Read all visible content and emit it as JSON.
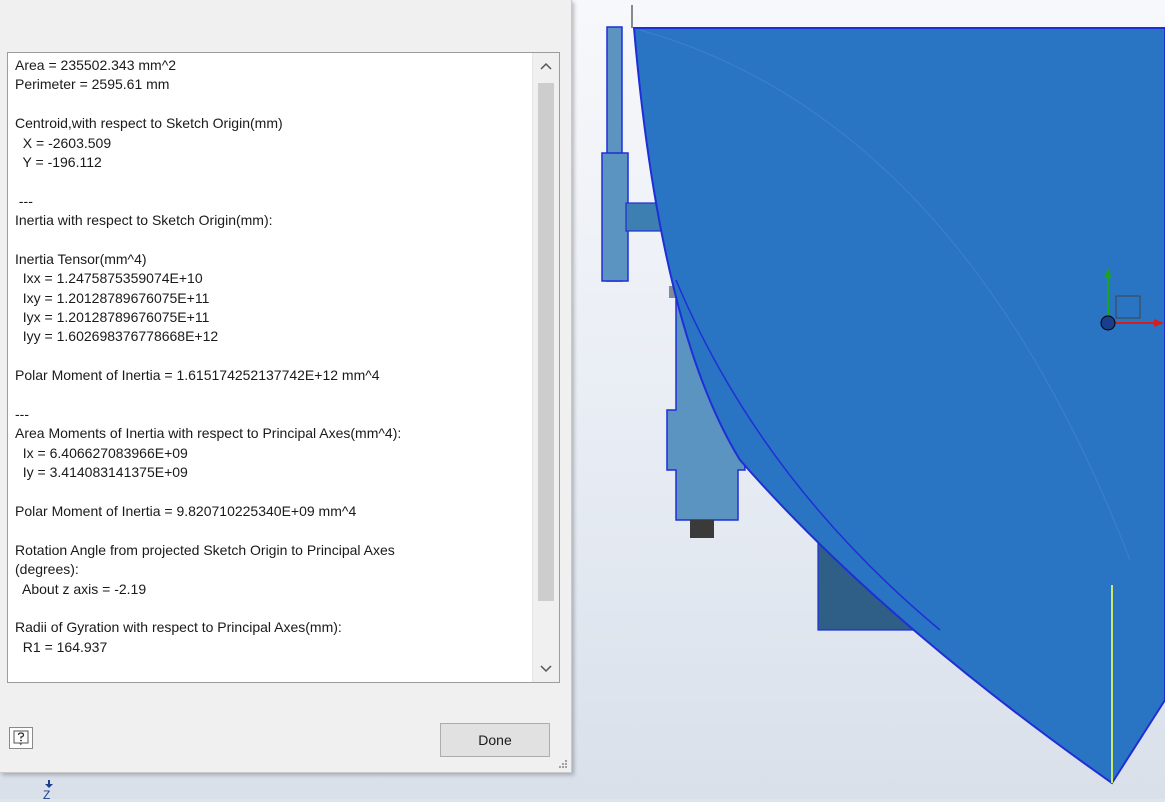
{
  "dialog": {
    "lines": [
      "Area = 235502.343 mm^2",
      "Perimeter = 2595.61 mm",
      "",
      "Centroid,with respect to Sketch Origin(mm)",
      "  X = -2603.509",
      "  Y = -196.112",
      "",
      " ---",
      "Inertia with respect to Sketch Origin(mm):",
      "",
      "Inertia Tensor(mm^4)",
      "  Ixx = 1.2475875359074E+10",
      "  Ixy = 1.20128789676075E+11",
      "  Iyx = 1.20128789676075E+11",
      "  Iyy = 1.602698376778668E+12",
      "",
      "Polar Moment of Inertia = 1.615174252137742E+12 mm^4",
      "",
      "---",
      "Area Moments of Inertia with respect to Principal Axes(mm^4):",
      "  Ix = 6.406627083966E+09",
      "  Iy = 3.414083141375E+09",
      "",
      "Polar Moment of Inertia = 9.820710225340E+09 mm^4",
      "",
      "Rotation Angle from projected Sketch Origin to Principal Axes",
      "(degrees):",
      "  About z axis = -2.19",
      "",
      "Radii of Gyration with respect to Principal Axes(mm):",
      "  R1 = 164.937"
    ],
    "done_label": "Done",
    "help_icon": "help-question-icon",
    "scroll_icons": [
      "chevron-up-icon",
      "chevron-down-icon"
    ]
  },
  "viewport": {
    "axis_label_z": "Z",
    "colors": {
      "body_blue": "#2a74c4",
      "body_edge": "#1f2fd6",
      "part_dark": "#3e7fb2",
      "part_light": "#5b93c1",
      "axis_x": "#d21f1f",
      "axis_y": "#19a31e",
      "axis_z": "#1a3e8c",
      "highlight": "#c9e86b"
    }
  }
}
